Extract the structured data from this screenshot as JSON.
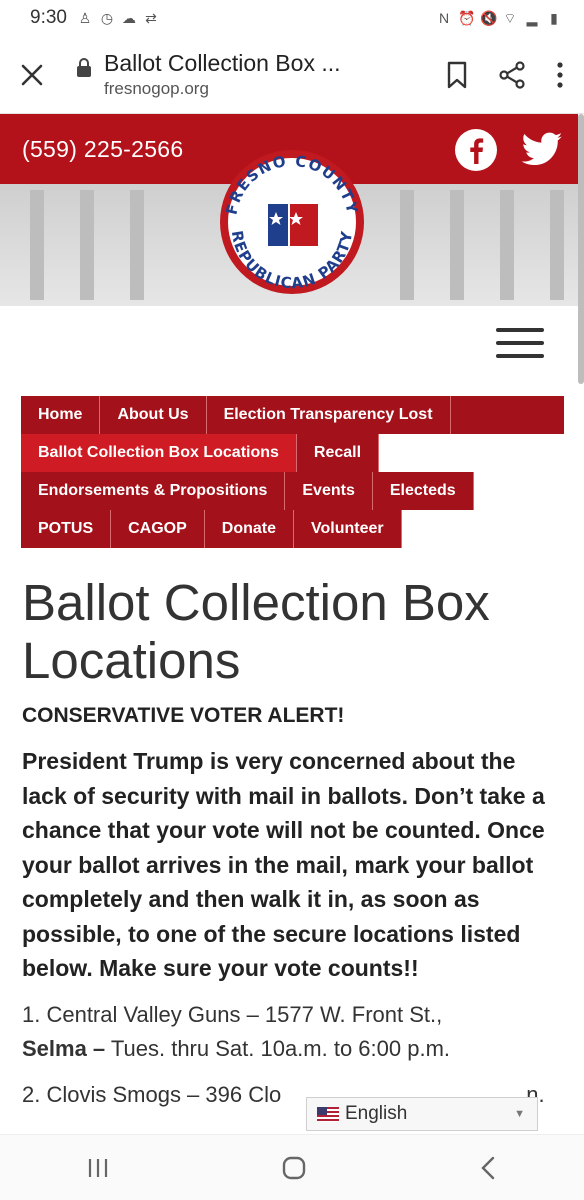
{
  "status_bar": {
    "time": "9:30"
  },
  "toolbar": {
    "title": "Ballot Collection Box ...",
    "url": "fresnogop.org"
  },
  "header": {
    "phone": "(559) 225-2566",
    "logo_text_top": "FRESNO COUNTY",
    "logo_text_bottom": "REPUBLICAN PARTY",
    "brand_color": "#b4121b"
  },
  "nav": {
    "rows": [
      [
        {
          "label": "Home"
        },
        {
          "label": "About Us"
        },
        {
          "label": "Election Transparency Lost"
        }
      ],
      [
        {
          "label": "Ballot Collection Box Locations",
          "active": true
        },
        {
          "label": "Recall"
        }
      ],
      [
        {
          "label": "Endorsements & Propositions"
        },
        {
          "label": "Events"
        },
        {
          "label": "Electeds"
        }
      ],
      [
        {
          "label": "POTUS"
        },
        {
          "label": "CAGOP"
        },
        {
          "label": "Donate"
        },
        {
          "label": "Volunteer"
        }
      ]
    ]
  },
  "content": {
    "title": "Ballot Collection Box Locations",
    "alert": "CONSERVATIVE VOTER ALERT!",
    "lead": "President Trump is very concerned about the lack of security with mail in ballots. Don’t take a chance that your vote will not be counted. Once your ballot arrives in the mail, mark your ballot completely and then walk it in, as soon as possible, to one of the secure locations listed below. Make sure your vote counts!!",
    "loc1_text": "1. Central Valley Guns  –  1577 W. Front St.,",
    "loc1_city": "Selma  –",
    "loc1_hours": "  Tues. thru Sat. 10a.m. to 6:00 p.m.",
    "loc2_text": "2. Clovis Smogs – 396 Clo",
    "loc2_tail": "n."
  },
  "translate": {
    "language": "English"
  }
}
